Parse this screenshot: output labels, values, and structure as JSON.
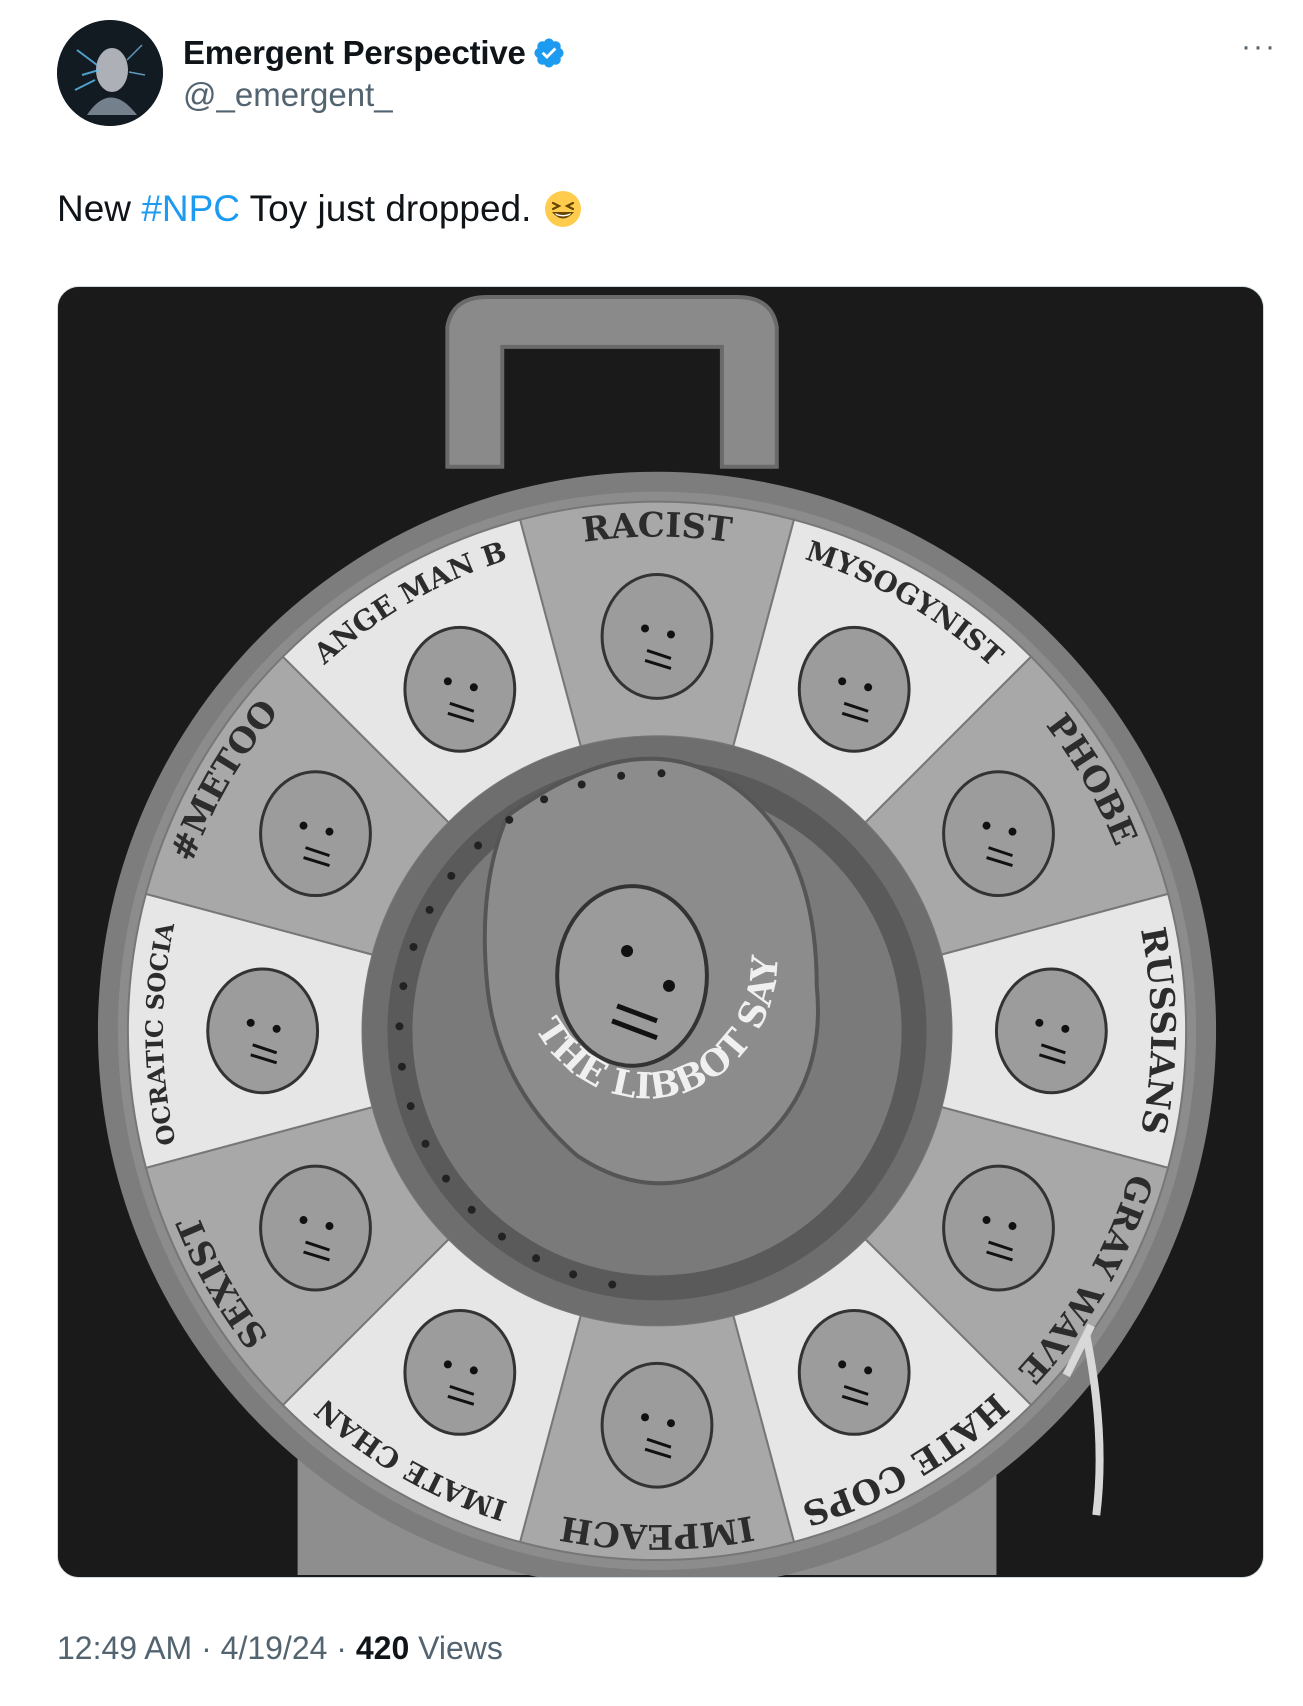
{
  "author": {
    "display_name": "Emergent Perspective",
    "handle": "@_emergent_",
    "verified": true,
    "avatar_icon": "avatar-image",
    "verified_color": "#1d9bf0"
  },
  "more_icon": "more-options-icon",
  "tweet": {
    "text_before": "New ",
    "hashtag": "#NPC",
    "text_after": " Toy just dropped.",
    "emoji": "grinning-squinting-face"
  },
  "media": {
    "description_icon": "npc-spinner-toy-image",
    "wheel_labels": [
      "RACIST",
      "MYSOGYNIST",
      "PHOBE",
      "RUSSIANS",
      "GRAY WAVE",
      "HATE COPS",
      "IMPEACH",
      "CLIMATE CHANGE",
      "SEXIST",
      "DEMOCRATIC SOCIALISM",
      "#METOO",
      "ORANGE MAN BAD"
    ],
    "center_label": "THE LIBBOT SAYS"
  },
  "meta": {
    "time": "12:49 AM",
    "separator": " · ",
    "date": "4/19/24",
    "views_count": "420",
    "views_label": " Views"
  },
  "colors": {
    "link": "#1d9bf0",
    "secondary_text": "#536471",
    "primary_text": "#0f1419"
  }
}
